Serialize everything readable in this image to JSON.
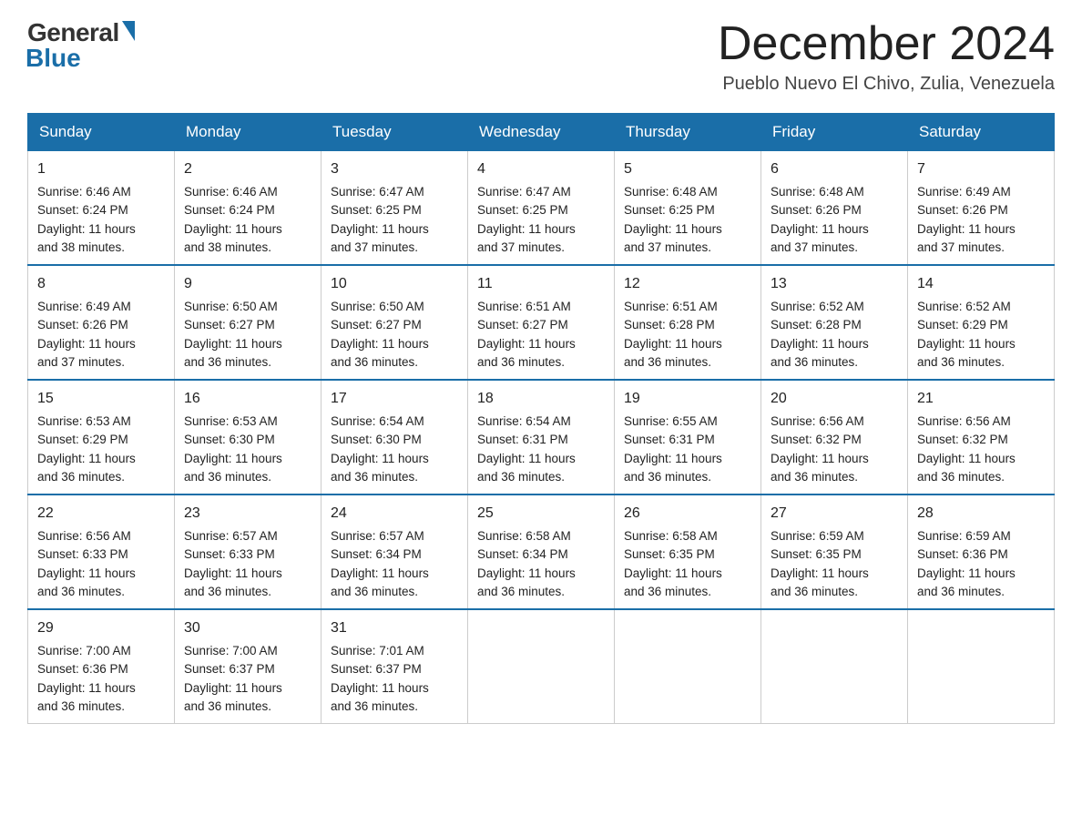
{
  "logo": {
    "general": "General",
    "blue": "Blue"
  },
  "header": {
    "title": "December 2024",
    "location": "Pueblo Nuevo El Chivo, Zulia, Venezuela"
  },
  "days": [
    "Sunday",
    "Monday",
    "Tuesday",
    "Wednesday",
    "Thursday",
    "Friday",
    "Saturday"
  ],
  "weeks": [
    [
      {
        "day": "1",
        "sunrise": "6:46 AM",
        "sunset": "6:24 PM",
        "daylight": "11 hours and 38 minutes."
      },
      {
        "day": "2",
        "sunrise": "6:46 AM",
        "sunset": "6:24 PM",
        "daylight": "11 hours and 38 minutes."
      },
      {
        "day": "3",
        "sunrise": "6:47 AM",
        "sunset": "6:25 PM",
        "daylight": "11 hours and 37 minutes."
      },
      {
        "day": "4",
        "sunrise": "6:47 AM",
        "sunset": "6:25 PM",
        "daylight": "11 hours and 37 minutes."
      },
      {
        "day": "5",
        "sunrise": "6:48 AM",
        "sunset": "6:25 PM",
        "daylight": "11 hours and 37 minutes."
      },
      {
        "day": "6",
        "sunrise": "6:48 AM",
        "sunset": "6:26 PM",
        "daylight": "11 hours and 37 minutes."
      },
      {
        "day": "7",
        "sunrise": "6:49 AM",
        "sunset": "6:26 PM",
        "daylight": "11 hours and 37 minutes."
      }
    ],
    [
      {
        "day": "8",
        "sunrise": "6:49 AM",
        "sunset": "6:26 PM",
        "daylight": "11 hours and 37 minutes."
      },
      {
        "day": "9",
        "sunrise": "6:50 AM",
        "sunset": "6:27 PM",
        "daylight": "11 hours and 36 minutes."
      },
      {
        "day": "10",
        "sunrise": "6:50 AM",
        "sunset": "6:27 PM",
        "daylight": "11 hours and 36 minutes."
      },
      {
        "day": "11",
        "sunrise": "6:51 AM",
        "sunset": "6:27 PM",
        "daylight": "11 hours and 36 minutes."
      },
      {
        "day": "12",
        "sunrise": "6:51 AM",
        "sunset": "6:28 PM",
        "daylight": "11 hours and 36 minutes."
      },
      {
        "day": "13",
        "sunrise": "6:52 AM",
        "sunset": "6:28 PM",
        "daylight": "11 hours and 36 minutes."
      },
      {
        "day": "14",
        "sunrise": "6:52 AM",
        "sunset": "6:29 PM",
        "daylight": "11 hours and 36 minutes."
      }
    ],
    [
      {
        "day": "15",
        "sunrise": "6:53 AM",
        "sunset": "6:29 PM",
        "daylight": "11 hours and 36 minutes."
      },
      {
        "day": "16",
        "sunrise": "6:53 AM",
        "sunset": "6:30 PM",
        "daylight": "11 hours and 36 minutes."
      },
      {
        "day": "17",
        "sunrise": "6:54 AM",
        "sunset": "6:30 PM",
        "daylight": "11 hours and 36 minutes."
      },
      {
        "day": "18",
        "sunrise": "6:54 AM",
        "sunset": "6:31 PM",
        "daylight": "11 hours and 36 minutes."
      },
      {
        "day": "19",
        "sunrise": "6:55 AM",
        "sunset": "6:31 PM",
        "daylight": "11 hours and 36 minutes."
      },
      {
        "day": "20",
        "sunrise": "6:56 AM",
        "sunset": "6:32 PM",
        "daylight": "11 hours and 36 minutes."
      },
      {
        "day": "21",
        "sunrise": "6:56 AM",
        "sunset": "6:32 PM",
        "daylight": "11 hours and 36 minutes."
      }
    ],
    [
      {
        "day": "22",
        "sunrise": "6:56 AM",
        "sunset": "6:33 PM",
        "daylight": "11 hours and 36 minutes."
      },
      {
        "day": "23",
        "sunrise": "6:57 AM",
        "sunset": "6:33 PM",
        "daylight": "11 hours and 36 minutes."
      },
      {
        "day": "24",
        "sunrise": "6:57 AM",
        "sunset": "6:34 PM",
        "daylight": "11 hours and 36 minutes."
      },
      {
        "day": "25",
        "sunrise": "6:58 AM",
        "sunset": "6:34 PM",
        "daylight": "11 hours and 36 minutes."
      },
      {
        "day": "26",
        "sunrise": "6:58 AM",
        "sunset": "6:35 PM",
        "daylight": "11 hours and 36 minutes."
      },
      {
        "day": "27",
        "sunrise": "6:59 AM",
        "sunset": "6:35 PM",
        "daylight": "11 hours and 36 minutes."
      },
      {
        "day": "28",
        "sunrise": "6:59 AM",
        "sunset": "6:36 PM",
        "daylight": "11 hours and 36 minutes."
      }
    ],
    [
      {
        "day": "29",
        "sunrise": "7:00 AM",
        "sunset": "6:36 PM",
        "daylight": "11 hours and 36 minutes."
      },
      {
        "day": "30",
        "sunrise": "7:00 AM",
        "sunset": "6:37 PM",
        "daylight": "11 hours and 36 minutes."
      },
      {
        "day": "31",
        "sunrise": "7:01 AM",
        "sunset": "6:37 PM",
        "daylight": "11 hours and 36 minutes."
      },
      null,
      null,
      null,
      null
    ]
  ],
  "labels": {
    "sunrise": "Sunrise:",
    "sunset": "Sunset:",
    "daylight": "Daylight:"
  }
}
